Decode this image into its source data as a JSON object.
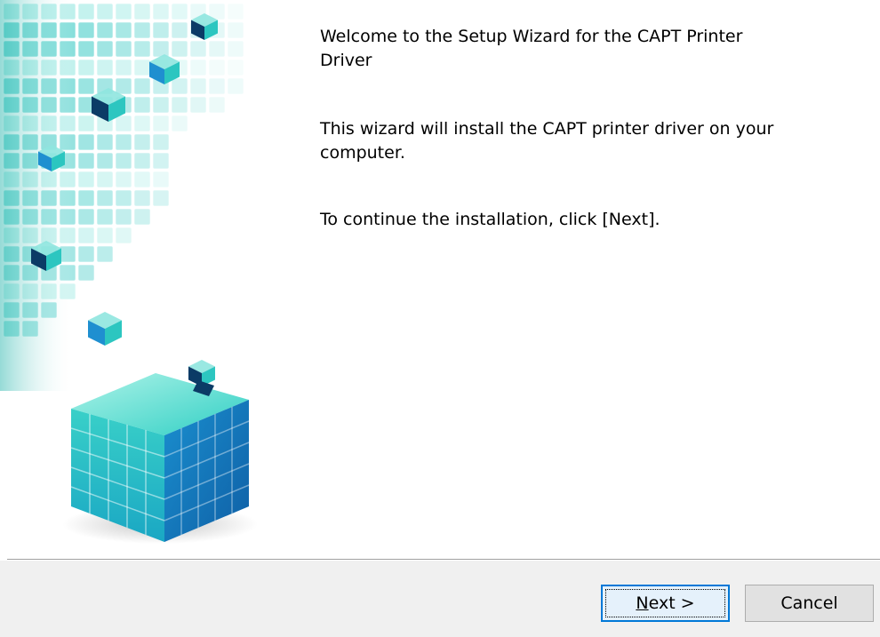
{
  "wizard": {
    "welcome_title": "Welcome to the Setup Wizard for the CAPT Printer Driver",
    "description": "This wizard will install the CAPT printer driver on your computer.",
    "continue_text": "To continue the installation, click [Next]."
  },
  "buttons": {
    "next_accel": "N",
    "next_rest": "ext >",
    "cancel_label": "Cancel"
  },
  "banner": {
    "icon": "cube-blocks-graphic",
    "colors": {
      "teal_light": "#8fe6df",
      "teal": "#2cc6c0",
      "blue": "#1f8fd0",
      "dark": "#0b3b66"
    }
  },
  "colors": {
    "focus_border": "#0078d7",
    "footer_bg": "#f0f0f0"
  }
}
